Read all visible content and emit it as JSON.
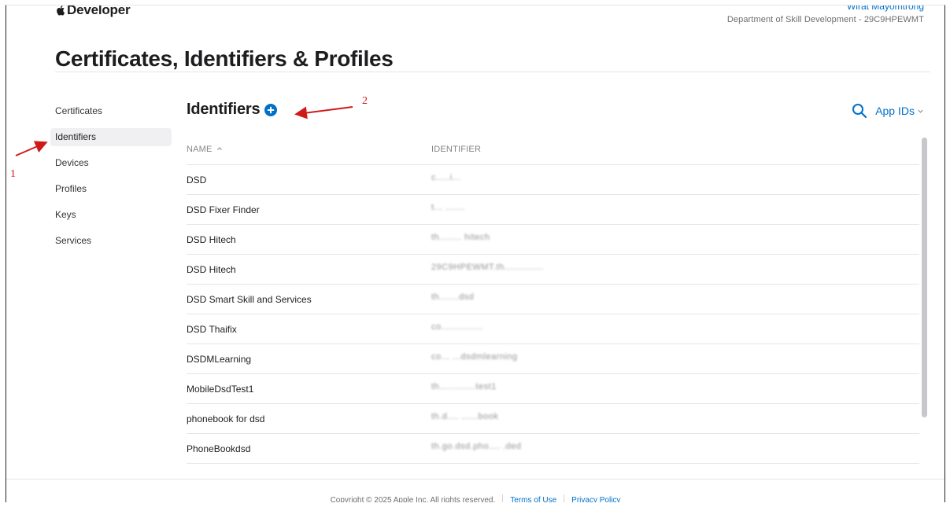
{
  "header": {
    "brand": "Developer",
    "account_name": "Wirat Mayomtrong",
    "team": "Department of Skill Development - 29C9HPEWMT"
  },
  "page_title": "Certificates, Identifiers & Profiles",
  "sidebar": {
    "items": [
      {
        "label": "Certificates",
        "active": false
      },
      {
        "label": "Identifiers",
        "active": true
      },
      {
        "label": "Devices",
        "active": false
      },
      {
        "label": "Profiles",
        "active": false
      },
      {
        "label": "Keys",
        "active": false
      },
      {
        "label": "Services",
        "active": false
      }
    ]
  },
  "section": {
    "title": "Identifiers",
    "add_icon": "plus-circle-icon",
    "filter_label": "App IDs"
  },
  "table": {
    "columns": {
      "name": "NAME",
      "identifier": "IDENTIFIER"
    },
    "rows": [
      {
        "name": "DSD",
        "identifier": "c.....i..."
      },
      {
        "name": "DSD Fixer Finder",
        "identifier": "t... ......."
      },
      {
        "name": "DSD Hitech",
        "identifier": "th........ hitech"
      },
      {
        "name": "DSD Hitech",
        "identifier": "29C9HPEWMT.th.............."
      },
      {
        "name": "DSD Smart Skill and Services",
        "identifier": "th.......dsd"
      },
      {
        "name": "DSD Thaifix",
        "identifier": "co..............."
      },
      {
        "name": "DSDMLearning",
        "identifier": "co... ...dsdmlearning"
      },
      {
        "name": "MobileDsdTest1",
        "identifier": "th.............test1"
      },
      {
        "name": "phonebook for dsd",
        "identifier": "th.d.... ......book"
      },
      {
        "name": "PhoneBookdsd",
        "identifier": "th.go.dsd.pho.... .ded"
      }
    ]
  },
  "footer": {
    "copyright": "Copyright © 2025 Apple Inc. All rights reserved.",
    "terms": "Terms of Use",
    "privacy": "Privacy Policy"
  },
  "annotations": {
    "label_1": "1",
    "label_2": "2",
    "color": "#d01a1a"
  },
  "colors": {
    "accent": "#0070c9",
    "text": "#1d1d1f",
    "muted": "#6e6e73",
    "active_bg": "#f0f0f2"
  }
}
